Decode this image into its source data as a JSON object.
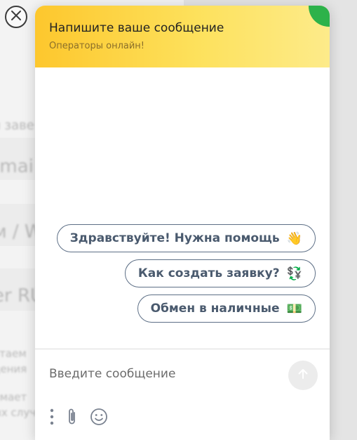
{
  "background_page": {
    "fragments": [
      "я заве",
      "-mai",
      "м / W",
      "er RU",
      "отаем",
      "дения",
      "имает",
      "ых случ"
    ]
  },
  "widget": {
    "header": {
      "title": "Напишите ваше сообщение",
      "subtitle": "Операторы онлайн!"
    },
    "quick_replies": [
      {
        "label": "Здравствуйте! Нужна помощь",
        "emoji": "👋"
      },
      {
        "label": "Как создать заявку?",
        "emoji": "💱"
      },
      {
        "label": "Обмен в наличные",
        "emoji": "💵"
      }
    ],
    "input": {
      "placeholder": "Введите сообщение"
    },
    "colors": {
      "header_start": "#fdc72d",
      "header_end": "#fdeb8a",
      "accent": "#2db24a",
      "chip_border": "#5d6f86"
    }
  },
  "icons": {
    "close": "close-icon",
    "send": "arrow-up-icon",
    "menu": "more-vertical-icon",
    "attach": "paperclip-icon",
    "emoji": "smiley-icon"
  }
}
